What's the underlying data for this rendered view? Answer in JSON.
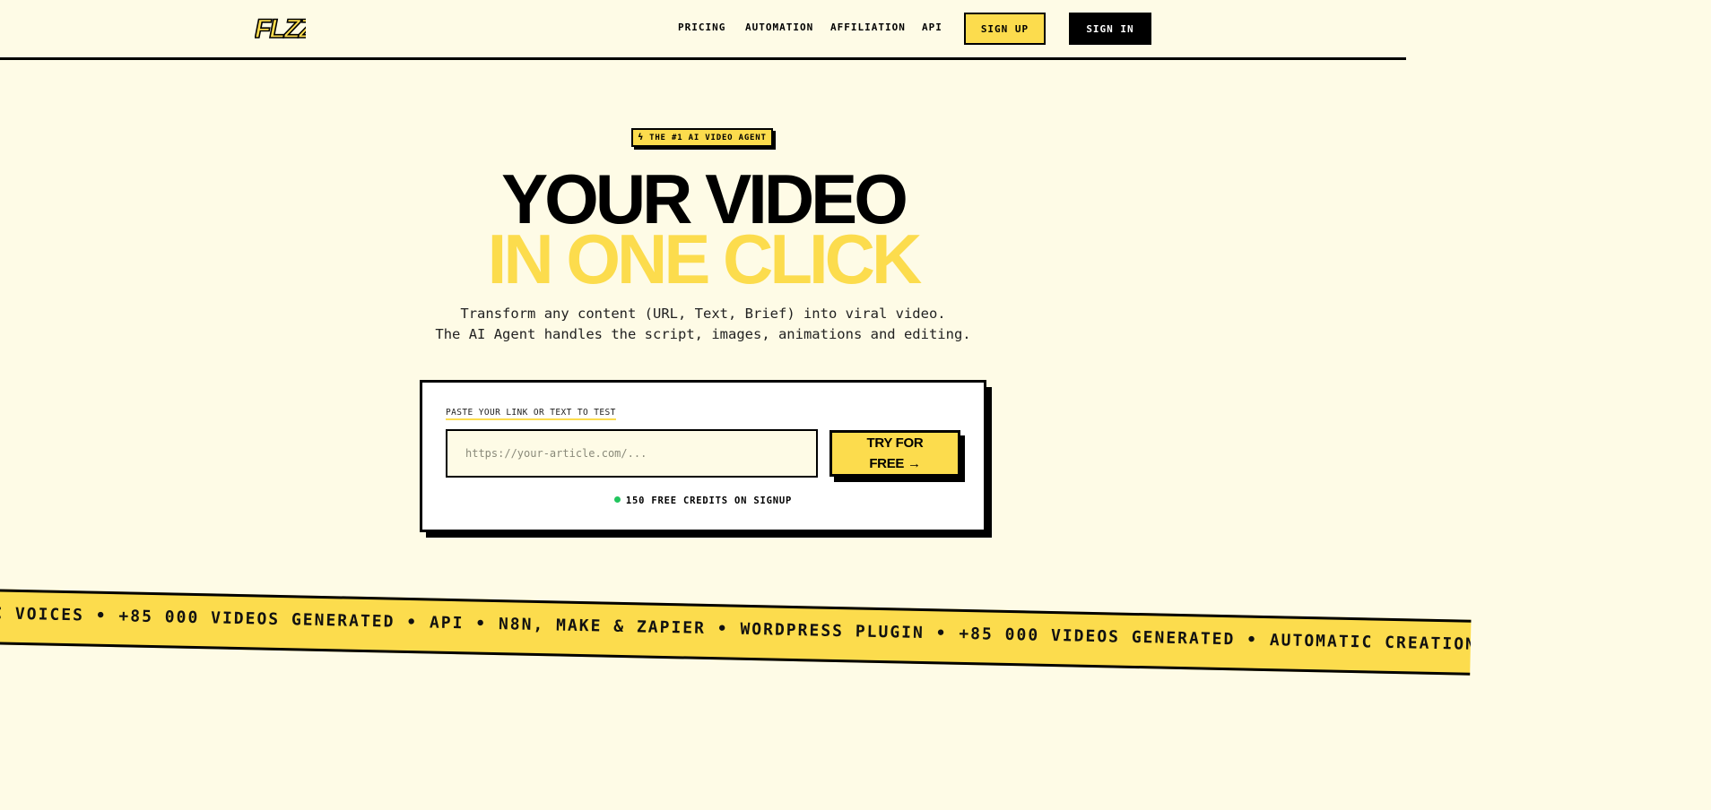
{
  "nav": {
    "logo_text": "FLZZ",
    "links": [
      "PRICING",
      "AUTOMATION",
      "AFFILIATION",
      "API"
    ],
    "signup_label": "SIGN UP",
    "signin_label": "SIGN IN"
  },
  "hero": {
    "badge_icon": "bolt-icon",
    "badge_text": "THE #1 AI VIDEO AGENT",
    "title_line1": "YOUR VIDEO",
    "title_line2": "IN ONE CLICK",
    "subtitle_line1": "Transform any content (URL, Text, Brief) into viral video.",
    "subtitle_line2": "The AI Agent handles the script, images, animations and editing."
  },
  "card": {
    "label": "PASTE YOUR LINK OR TEXT TO TEST",
    "input_placeholder": "https://your-article.com/...",
    "input_value": "",
    "cta_line1": "TRY FOR",
    "cta_line2": "FREE →",
    "credits_text": "150 FREE CREDITS ON SIGNUP"
  },
  "marquee": {
    "text": "C VOICES • +85 000 VIDEOS GENERATED • API • N8N, MAKE & ZAPIER • WORDPRESS PLUGIN • +85 000 VIDEOS GENERATED • AUTOMATIC CREATION"
  },
  "colors": {
    "background": "#fefbe6",
    "accent": "#fcdc4d",
    "ink": "#000000",
    "status_dot": "#22c55e"
  }
}
